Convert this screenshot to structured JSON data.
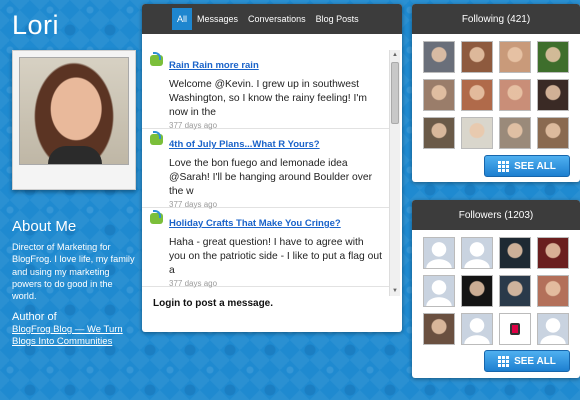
{
  "profile": {
    "name": "Lori",
    "about_title": "About Me",
    "about_text": "Director of Marketing for BlogFrog. I love life, my family and using my marketing powers to do good in the world.",
    "author_of_label": "Author of",
    "author_link": "BlogFrog Blog — We Turn Blogs Into Communities"
  },
  "messages": {
    "tabs": [
      {
        "label": "All",
        "active": true
      },
      {
        "label": "Messages"
      },
      {
        "label": "Conversations"
      },
      {
        "label": "Blog Posts"
      }
    ],
    "posts": [
      {
        "title": "Rain Rain more rain",
        "body": "Welcome @Kevin. I grew up in southwest Washington, so I know the rainy feeling! I'm now in the",
        "time": "377 days ago"
      },
      {
        "title": "4th of July Plans...What R Yours?",
        "body": "Love the bon fuego and lemonade idea @Sarah!  I'll be hanging around Boulder over the w",
        "time": "377 days ago"
      },
      {
        "title": "Holiday Crafts That Make You Cringe?",
        "body": "Haha - great question! I have to agree with you on the patriotic side - I like to put a flag out a",
        "time": "377 days ago"
      }
    ],
    "login_prompt": "Login to post a message."
  },
  "following": {
    "title": "Following (421)",
    "see_all": "SEE ALL",
    "avatars": [
      "#6a6f7a",
      "#8e5a3e",
      "#c99a7a",
      "#3e6e2c",
      "#9a7d6a",
      "#b06a4a",
      "#c98e78",
      "#3a2a25",
      "#6a5a48",
      "#d9d6cc",
      "#9a8a7a",
      "#8a6a50"
    ]
  },
  "followers": {
    "title": "Followers (1203)",
    "see_all": "SEE ALL",
    "avatars": [
      "blank",
      "blank",
      "#1e2a33",
      "#6a1e1e",
      "blank",
      "#141414",
      "#2a3a4a",
      "#b3705a",
      "#6a5040",
      "blank",
      "logo",
      "blank"
    ]
  }
}
